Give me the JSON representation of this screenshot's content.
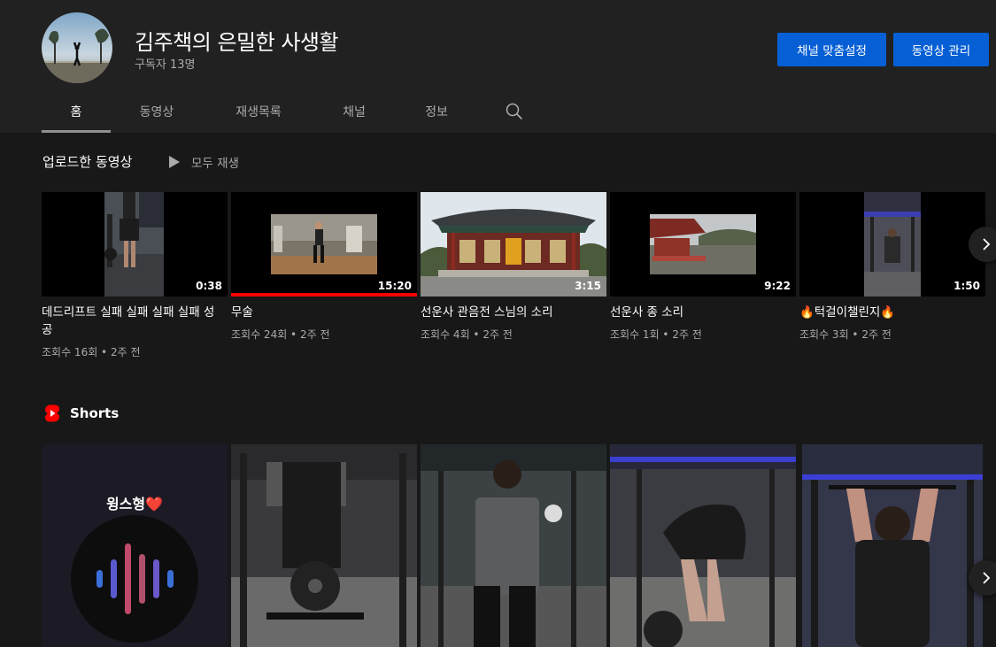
{
  "channel": {
    "title": "김주책의 은밀한 사생활",
    "subscribers": "구독자 13명",
    "customize_label": "채널 맞춤설정",
    "manage_label": "동영상 관리"
  },
  "tabs": [
    {
      "label": "홈",
      "active": true
    },
    {
      "label": "동영상",
      "active": false
    },
    {
      "label": "재생목록",
      "active": false
    },
    {
      "label": "채널",
      "active": false
    },
    {
      "label": "정보",
      "active": false
    }
  ],
  "uploads": {
    "title": "업로드한 동영상",
    "play_all": "모두 재생",
    "videos": [
      {
        "title": "데드리프트 실패 실패 실패 실패 성공",
        "duration": "0:38",
        "views": "조회수 16회",
        "age": "2주 전",
        "meta": "조회수 16회 • 2주 전"
      },
      {
        "title": "무술",
        "duration": "15:20",
        "views": "조회수 24회",
        "age": "2주 전",
        "meta": "조회수 24회 • 2주 전",
        "watched": 1.0
      },
      {
        "title": "선운사 관음전 스님의 소리",
        "duration": "3:15",
        "views": "조회수 4회",
        "age": "2주 전",
        "meta": "조회수 4회 • 2주 전"
      },
      {
        "title": "선운사 종 소리",
        "duration": "9:22",
        "views": "조회수 1회",
        "age": "2주 전",
        "meta": "조회수 1회 • 2주 전"
      },
      {
        "title": "🔥턱걸이챌린지🔥",
        "duration": "1:50",
        "views": "조회수 3회",
        "age": "2주 전",
        "meta": "조회수 3회 • 2주 전"
      }
    ]
  },
  "shorts": {
    "title": "Shorts",
    "first_card_text": "윙스형❤️"
  },
  "colors": {
    "background": "#181818",
    "header": "#212121",
    "accent_blue": "#065fd4",
    "progress_red": "#ff0000",
    "secondary_text": "#aaaaaa"
  },
  "icons": [
    "search-icon",
    "play-icon",
    "chevron-right-icon",
    "shorts-logo-icon",
    "waveform-icon"
  ]
}
